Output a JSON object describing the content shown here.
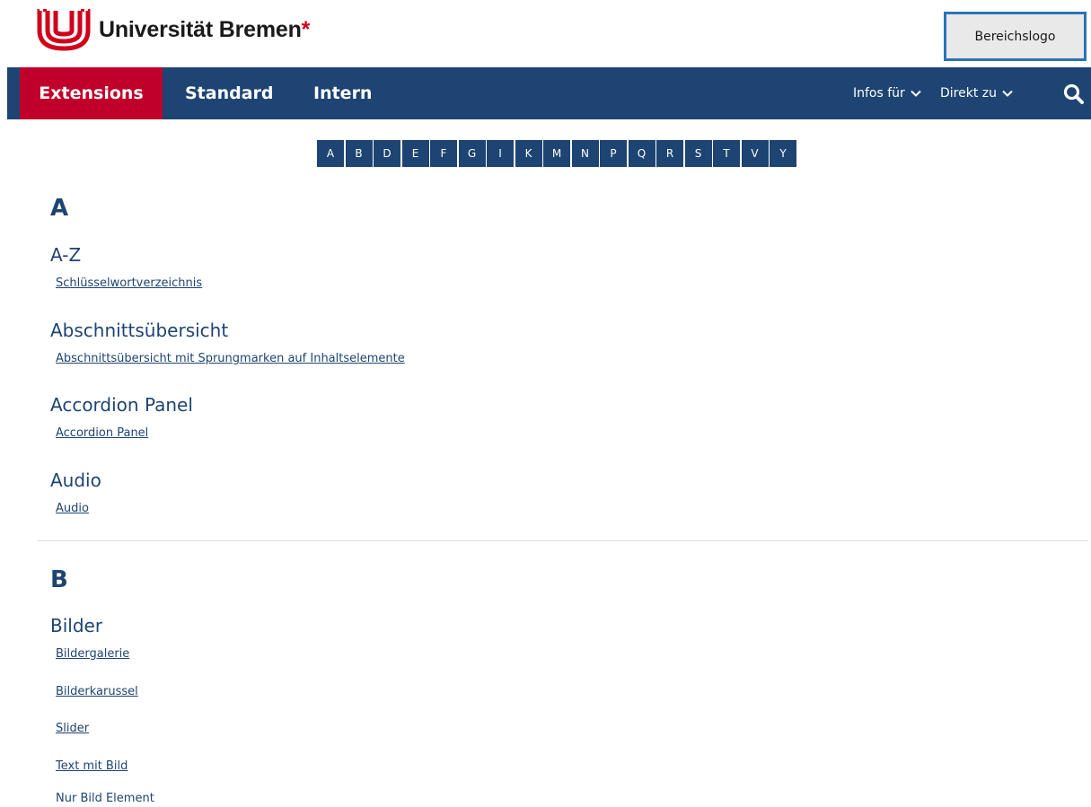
{
  "header": {
    "logo_text": "Universität Bremen",
    "logo_star": "*",
    "bereichslogo": "Bereichslogo"
  },
  "nav": {
    "items": [
      {
        "label": "Extensions",
        "active": true
      },
      {
        "label": "Standard"
      },
      {
        "label": "Intern"
      }
    ],
    "right": [
      {
        "label": "Infos für"
      },
      {
        "label": "Direkt zu"
      }
    ],
    "search_icon": "search-icon"
  },
  "alphabet": [
    "A",
    "B",
    "D",
    "E",
    "F",
    "G",
    "I",
    "K",
    "M",
    "N",
    "P",
    "Q",
    "R",
    "S",
    "T",
    "V",
    "Y"
  ],
  "sections": [
    {
      "letter": "A",
      "groups": [
        {
          "title": "A-Z",
          "links": [
            "Schlüsselwortverzeichnis"
          ]
        },
        {
          "title": "Abschnittsübersicht",
          "links": [
            "Abschnittsübersicht mit Sprungmarken auf Inhaltselemente"
          ]
        },
        {
          "title": "Accordion Panel",
          "links": [
            "Accordion Panel"
          ]
        },
        {
          "title": "Audio",
          "links": [
            "Audio"
          ]
        }
      ]
    },
    {
      "letter": "B",
      "groups": [
        {
          "title": "Bilder",
          "links": [
            "Bildergalerie",
            "Bilderkarussel",
            "Slider",
            "Text mit Bild",
            "Nur Bild Element"
          ]
        }
      ]
    }
  ],
  "colors": {
    "primary": "#1d4472",
    "accent": "#c0002a",
    "logo_red": "#d0021b",
    "bereichslogo_border": "#2a74b8"
  }
}
